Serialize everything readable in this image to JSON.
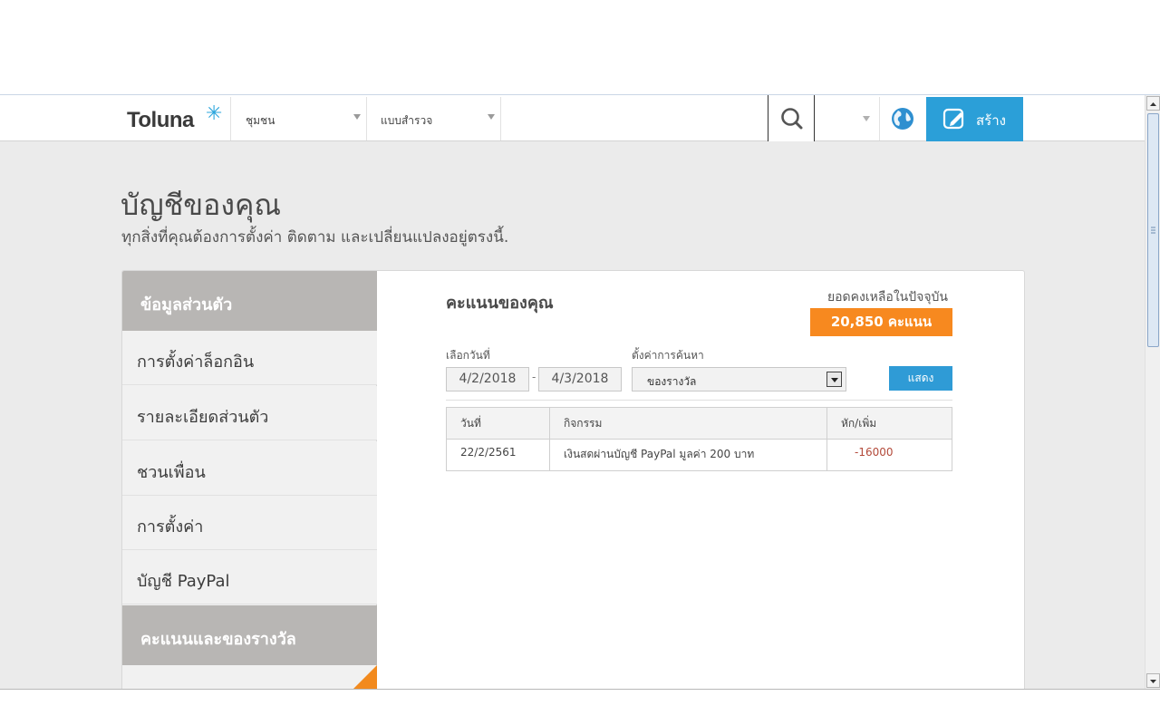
{
  "header": {
    "logo": "Toluna",
    "nav": [
      {
        "label": "ชุมชน"
      },
      {
        "label": "แบบสำรวจ"
      }
    ],
    "create_label": "สร้าง"
  },
  "page": {
    "title": "บัญชีของคุณ",
    "subtitle": "ทุกสิ่งที่คุณต้องการตั้งค่า ติดตาม และเปลี่ยนแปลงอยู่ตรงนี้."
  },
  "sidebar": {
    "section1": "ข้อมูลส่วนตัว",
    "items": [
      {
        "label": "การตั้งค่าล็อกอิน"
      },
      {
        "label": "รายละเอียดส่วนตัว"
      },
      {
        "label": "ชวนเพื่อน"
      },
      {
        "label": "การตั้งค่า"
      },
      {
        "label": "บัญชี PayPal"
      }
    ],
    "section2": "คะแนนและของรางวัล"
  },
  "main": {
    "title": "คะแนนของคุณ",
    "balance_label": "ยอดคงเหลือในปัจจุบัน",
    "balance_value": "20,850 คะแนน",
    "date_label": "เลือกวันที่",
    "date_from": "4/2/2018",
    "date_sep": "-",
    "filter_label": "ตั้งค่าการค้นหา",
    "filter_value": "ของรางวัล",
    "show_button": "แสดง",
    "table": {
      "headers": [
        "วันที่",
        "กิจกรรม",
        "หัก/เพิ่ม"
      ],
      "rows": [
        [
          "22/2/2561",
          "เงินสดผ่านบัญชี PayPal มูลค่า 200 บาท",
          "-16000"
        ]
      ]
    },
    "date_to": "4/3/2018"
  },
  "colors": {
    "accent_blue": "#2b9fd8",
    "accent_orange": "#f7891f",
    "sidebar_header": "#b8b6b4"
  }
}
